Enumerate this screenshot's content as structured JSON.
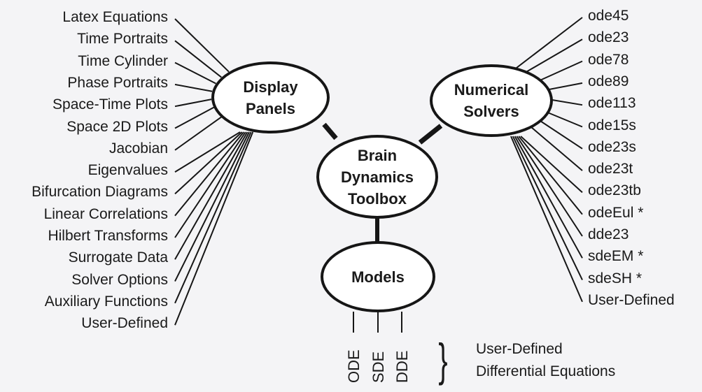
{
  "center": {
    "label_lines": [
      "Brain",
      "Dynamics",
      "Toolbox"
    ]
  },
  "display_panels": {
    "label_lines": [
      "Display",
      "Panels"
    ],
    "items": [
      "Latex Equations",
      "Time Portraits",
      "Time Cylinder",
      "Phase Portraits",
      "Space-Time Plots",
      "Space 2D Plots",
      "Jacobian",
      "Eigenvalues",
      "Bifurcation Diagrams",
      "Linear Correlations",
      "Hilbert Transforms",
      "Surrogate Data",
      "Solver Options",
      "Auxiliary Functions",
      "User-Defined"
    ]
  },
  "numerical_solvers": {
    "label_lines": [
      "Numerical",
      "Solvers"
    ],
    "items": [
      "ode45",
      "ode23",
      "ode78",
      "ode89",
      "ode113",
      "ode15s",
      "ode23s",
      "ode23t",
      "ode23tb",
      "odeEul *",
      "dde23",
      "sdeEM *",
      "sdeSH *",
      "User-Defined"
    ]
  },
  "models": {
    "label": "Models",
    "types": [
      "ODE",
      "SDE",
      "DDE"
    ],
    "note_lines": [
      "User-Defined",
      "Differential Equations"
    ],
    "brace": "}"
  },
  "colors": {
    "background": "#f4f4f6",
    "stroke": "#161616",
    "node_fill": "#ffffff"
  }
}
